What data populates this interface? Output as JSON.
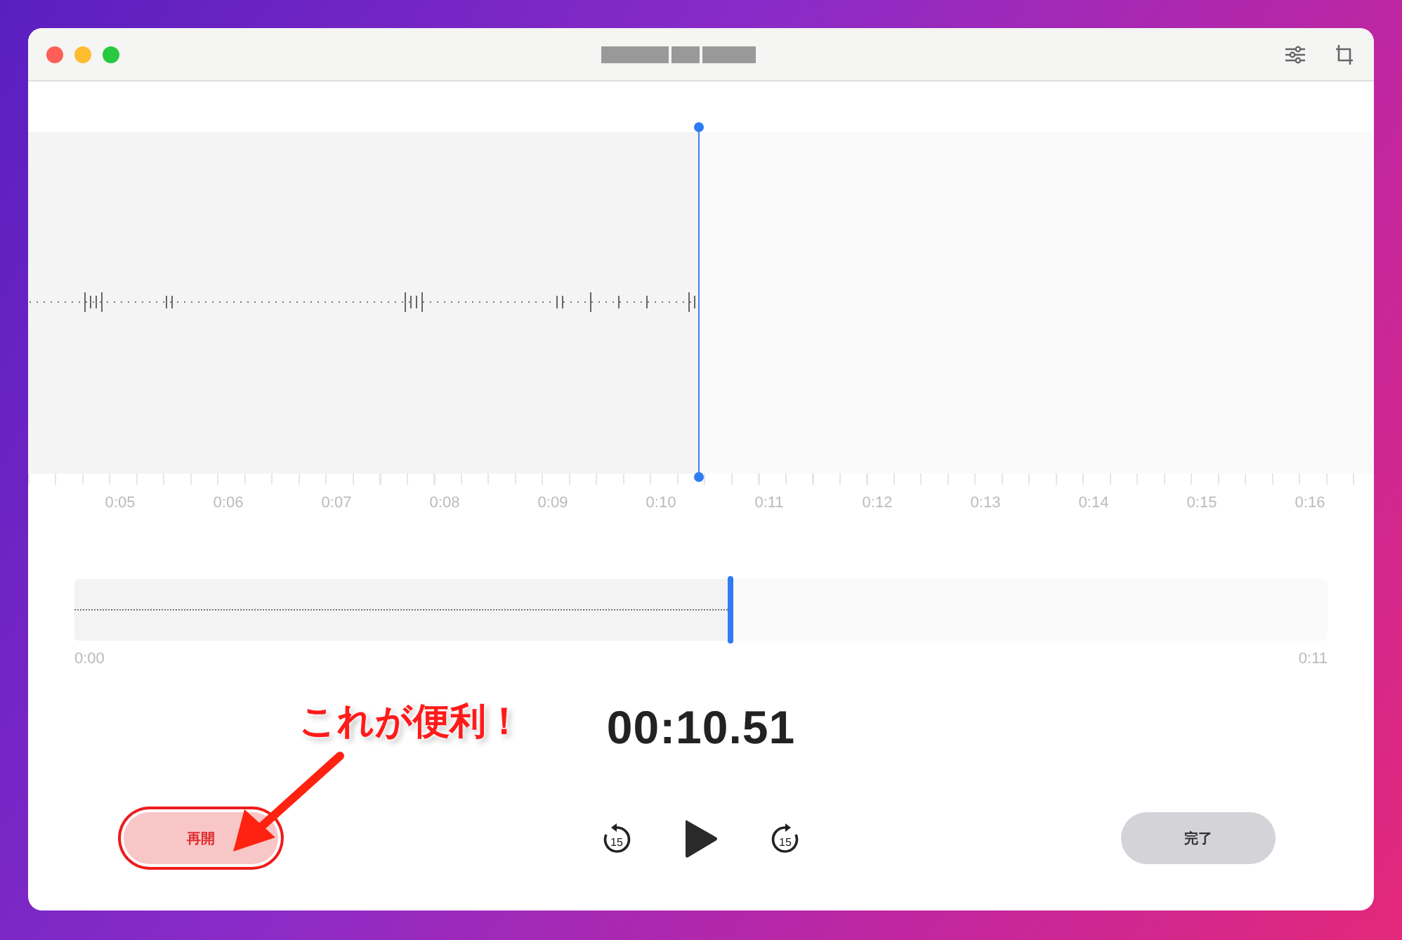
{
  "window": {
    "title_redacted": true
  },
  "toolbar": {
    "buttons": [
      {
        "kind": "sliders"
      },
      {
        "kind": "crop"
      }
    ]
  },
  "timeline": {
    "labels": [
      "0:05",
      "0:06",
      "0:07",
      "0:08",
      "0:09",
      "0:10",
      "0:11",
      "0:12",
      "0:13",
      "0:14",
      "0:15",
      "0:16"
    ]
  },
  "overview": {
    "level": 0.524,
    "start": "0:00",
    "end": "0:11"
  },
  "timer": "00:10.51",
  "controls": {
    "skip_back": "15",
    "skip_forward": "15",
    "resume": {
      "label": "再開",
      "highlighted": true
    },
    "done": {
      "label": "完了"
    }
  },
  "annotation": {
    "text": "これが便利！"
  }
}
